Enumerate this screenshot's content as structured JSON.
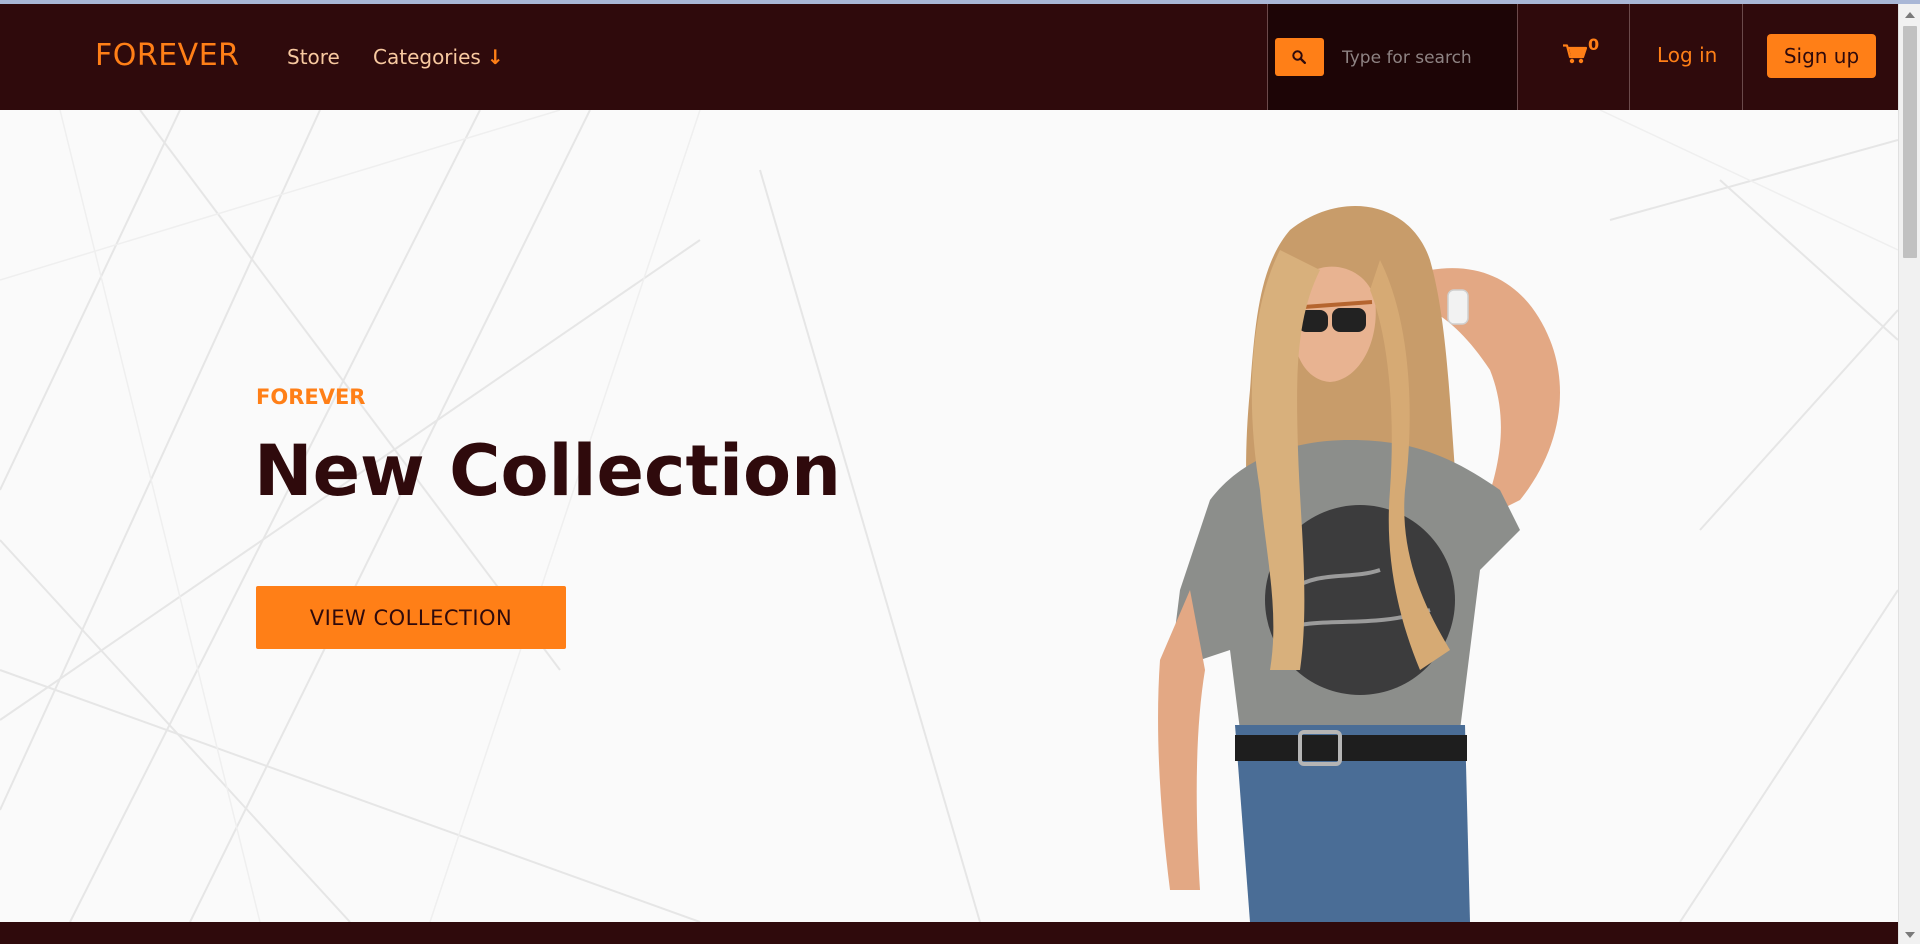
{
  "colors": {
    "nav_bg": "#2f0a0c",
    "accent": "#ff7f17",
    "nav_link": "#f8c9a0",
    "hero_title": "#2f0a0c"
  },
  "navbar": {
    "brand": "FOREVER",
    "links": [
      {
        "label": "Store"
      },
      {
        "label": "Categories",
        "icon": "arrow-down-icon"
      }
    ],
    "search": {
      "icon": "search-icon",
      "placeholder": "Type for search",
      "value": ""
    },
    "cart": {
      "icon": "cart-icon",
      "count": "0"
    },
    "login_label": "Log in",
    "signup_label": "Sign up"
  },
  "hero": {
    "kicker": "FOREVER",
    "title": "New Collection",
    "cta_label": "VIEW COLLECTION",
    "image": "woman-in-grey-t-shirt-photo"
  }
}
